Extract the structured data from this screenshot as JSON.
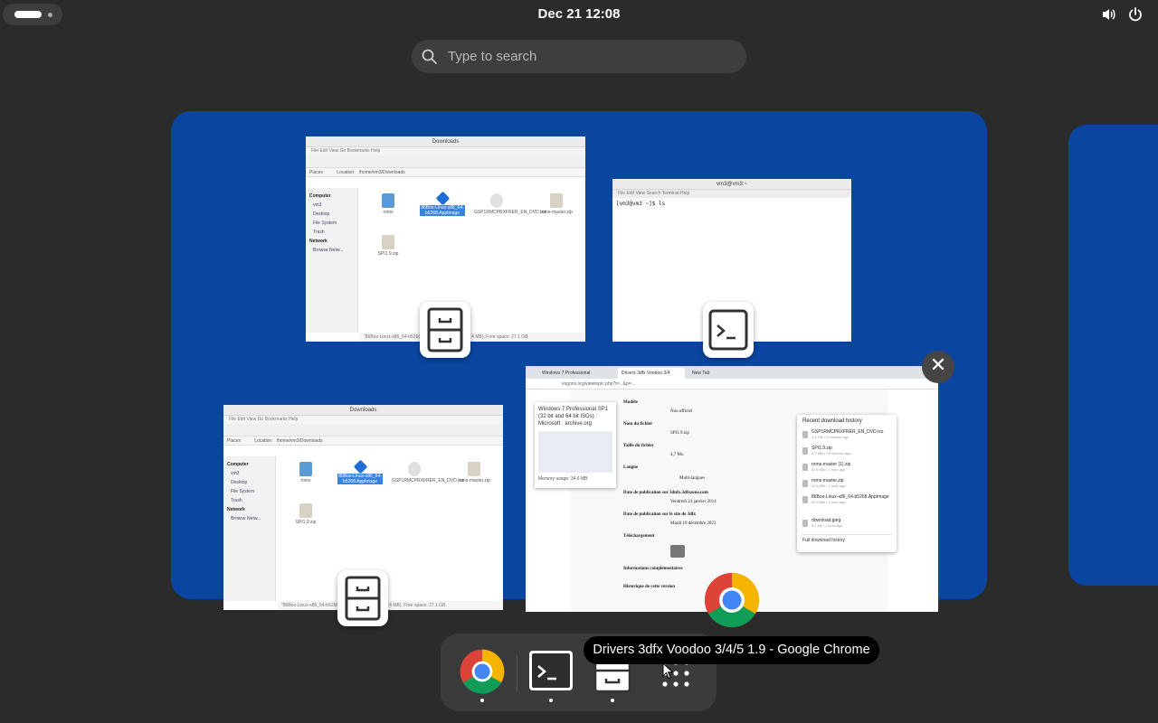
{
  "topbar": {
    "clock": "Dec 21  12:08",
    "icons": [
      "activities-indicator",
      "volume-icon",
      "power-icon"
    ]
  },
  "search": {
    "placeholder": "Type to search",
    "icon": "search-icon"
  },
  "windows": {
    "files_top": {
      "title": "Downloads",
      "menu": "File  Edit  View  Go  Bookmarks  Help",
      "location_label": "Location:",
      "location": "/home/vm3/Downloads",
      "sidebar": {
        "places": "Places",
        "computer": "Computer",
        "items": [
          "vm3",
          "Desktop",
          "File System",
          "Trash"
        ],
        "network": "Network",
        "network_items": [
          "Browse Netw..."
        ]
      },
      "files": [
        {
          "name": "roms",
          "type": "folder"
        },
        {
          "name": "86Box-Linux-x86_64-b5268.AppImage",
          "type": "app",
          "selected": true
        },
        {
          "name": "GSP1RMCPRXFRER_EN_DVD.iso",
          "type": "disc"
        },
        {
          "name": "roms-master.zip",
          "type": "zip"
        },
        {
          "name": "SPI1.9.zip",
          "type": "zip"
        }
      ],
      "status": "\"86Box-Linux-x86_64-b5268.AppImage\" selected (53.4 MB), Free space: 27.1 GB"
    },
    "terminal": {
      "title": "vm3@vm3:~",
      "menu": "File  Edit  View  Search  Terminal  Help",
      "line": "[vm3@vm3 ~]$ ls"
    },
    "files_bottom": {
      "title": "Downloads",
      "menu": "File  Edit  View  Go  Bookmarks  Help",
      "location_label": "Location:",
      "location": "/home/vm3/Downloads",
      "sidebar": {
        "places": "Places",
        "computer": "Computer",
        "items": [
          "vm3",
          "Desktop",
          "File System",
          "Trash"
        ],
        "network": "Network",
        "network_items": [
          "Browse Netw..."
        ]
      },
      "files": [
        {
          "name": "roms",
          "type": "folder"
        },
        {
          "name": "86Box-Linux-x86_64-b5268.AppImage",
          "type": "app",
          "selected": true
        },
        {
          "name": "GSP1RMCPRXFRER_EN_DVD.iso",
          "type": "disc"
        },
        {
          "name": "roms-master.zip",
          "type": "zip"
        },
        {
          "name": "SPI1.9.zip",
          "type": "zip"
        }
      ],
      "status": "\"86Box-Linux-x86_64-b5268.AppImage\" selected (53.4 MB), Free space: 27.1 GB"
    },
    "chrome": {
      "tabs": [
        "Windows 7 Professional",
        "Drivers 3dfx Voodoo 3/4",
        "New Tab"
      ],
      "address": "vogons.org/viewtopic.php?t=...&p=...",
      "popup_title": "Windows 7 Professional SP1 (32 bit and 64 bit ISOs) : Microsoft : archive.org",
      "popup_memory": "Memory usage: 34.6 MB",
      "page_rows": [
        {
          "label": "Modèle",
          "value": "Non officiel"
        },
        {
          "label": "Nom du fichier",
          "value": "SPI1.9.zip"
        },
        {
          "label": "Taille du fichier",
          "value": "4,7 Mo"
        },
        {
          "label": "Langue",
          "value": "Multi-langues"
        },
        {
          "label": "Date de publication sur 3dnfx.3dfxzone.com",
          "value": "Vendredi 24 janvier 2014"
        },
        {
          "label": "Date de publication sur le site de 3dfx",
          "value": "Mardi 19 décembre 2023"
        },
        {
          "label": "Téléchargement",
          "value": ""
        },
        {
          "label": "Informations complémentaires",
          "value": ""
        },
        {
          "label": "Historique de cette version",
          "value": ""
        }
      ],
      "downloads": {
        "title": "Recent download history",
        "items": [
          {
            "name": "GSP1RMCPRXFRER_EN_DVD.iso",
            "meta": "3.4 GB • 9 minutes ago"
          },
          {
            "name": "SPI1.9.zip",
            "meta": "4.7 MB • 28 minutes ago"
          },
          {
            "name": "roms-master (1).zip",
            "meta": "42.6 MB • 1 hour ago"
          },
          {
            "name": "roms-master.zip",
            "meta": "42.6 MB • 1 hour ago"
          },
          {
            "name": "86Box-Linux-x86_64-b5268.AppImage",
            "meta": "53.4 MB • 1 hour ago"
          },
          {
            "name": "download.jpeg",
            "meta": "8.1 kB • 1 hour ago"
          }
        ],
        "footer": "Full download history"
      }
    }
  },
  "dash": {
    "items": [
      {
        "name": "Google Chrome",
        "icon": "chrome-icon",
        "running": true
      },
      {
        "name": "Terminal",
        "icon": "terminal-icon",
        "running": true
      },
      {
        "name": "Files",
        "icon": "file-cabinet-icon",
        "running": true
      },
      {
        "name": "Show Apps",
        "icon": "app-grid-icon",
        "running": false
      }
    ]
  },
  "tooltip": "Drivers 3dfx Voodoo 3/4/5 1.9 - Google Chrome",
  "colors": {
    "background": "#2b2b2b",
    "workspace": "#0a46a0",
    "accent": "#3584e4"
  }
}
